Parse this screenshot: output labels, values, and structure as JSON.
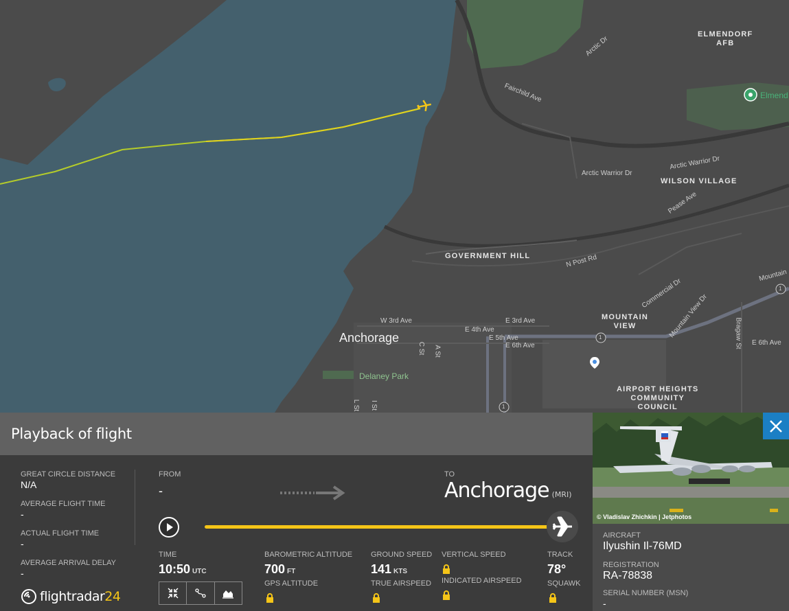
{
  "map": {
    "labels": {
      "elmendorf_afb": "ELMENDORF\nAFB",
      "elmendorf_poi": "Elmend",
      "arctic_warrior_dr_1": "Arctic Warrior Dr",
      "arctic_warrior_dr_2": "Arctic Warrior Dr",
      "wilson_village": "WILSON VILLAGE",
      "fairchild_ave": "Fairchild Ave",
      "arctic_dr": "Arctic Dr",
      "pease_ave": "Pease Ave",
      "government_hill": "GOVERNMENT HILL",
      "n_post_rd": "N Post Rd",
      "commercial_dr": "Commercial Dr",
      "mountain_view_dr": "Mountain View Dr",
      "mountain_view": "MOUNTAIN\nVIEW",
      "mountain_edge": "Mountain",
      "bragaw_st": "Bragaw St",
      "e_6th_ave_right": "E 6th Ave",
      "w_3rd_ave": "W 3rd Ave",
      "e_3rd_ave": "E 3rd Ave",
      "e_4th_ave": "E 4th Ave",
      "e_5th_ave": "E 5th Ave",
      "e_6th_ave": "E 6th Ave",
      "anchorage": "Anchorage",
      "c_st": "C St",
      "a_st": "A St",
      "delaney_park": "Delaney Park",
      "l_st": "L St",
      "i_st": "I St",
      "airport_heights": "AIRPORT HEIGHTS\nCOMMUNITY\nCOUNCIL",
      "route_1a": "1",
      "route_1b": "1",
      "route_1c": "1"
    },
    "colors": {
      "water": "#44606d",
      "land": "#4b4b4b",
      "track_yellow": "#e8d21c",
      "track_green": "#9ccc2a",
      "park": "#4f6a50"
    }
  },
  "panel": {
    "title": "Playback of flight",
    "stats": {
      "great_circle_distance_label": "GREAT CIRCLE DISTANCE",
      "great_circle_distance_value": "N/A",
      "average_flight_time_label": "AVERAGE FLIGHT TIME",
      "average_flight_time_value": "-",
      "actual_flight_time_label": "ACTUAL FLIGHT TIME",
      "actual_flight_time_value": "-",
      "average_arrival_delay_label": "AVERAGE ARRIVAL DELAY",
      "average_arrival_delay_value": "-"
    },
    "route": {
      "from_label": "FROM",
      "from_value": "-",
      "to_label": "TO",
      "to_city": "Anchorage",
      "to_code": "(MRI)"
    },
    "playback": {
      "progress": 1.0
    },
    "telemetry": {
      "time_label": "TIME",
      "time_value": "10:50",
      "time_unit": "UTC",
      "baro_alt_label": "BAROMETRIC ALTITUDE",
      "baro_alt_value": "700",
      "baro_alt_unit": "FT",
      "gps_alt_label": "GPS ALTITUDE",
      "ground_speed_label": "GROUND SPEED",
      "ground_speed_value": "141",
      "ground_speed_unit": "KTS",
      "true_airspeed_label": "TRUE AIRSPEED",
      "vertical_speed_label": "VERTICAL SPEED",
      "indicated_airspeed_label": "INDICATED AIRSPEED",
      "track_label": "TRACK",
      "track_value": "78°",
      "squawk_label": "SQUAWK"
    },
    "logo": {
      "text": "flightradar",
      "suffix": "24"
    }
  },
  "aircraft": {
    "photo_credit": "© Vladislav Zhichkin | Jetphotos",
    "aircraft_label": "AIRCRAFT",
    "aircraft_value": "Ilyushin Il-76MD",
    "registration_label": "REGISTRATION",
    "registration_value": "RA-78838",
    "serial_label": "SERIAL NUMBER (MSN)",
    "serial_value": "-"
  },
  "colors": {
    "accent_yellow": "#f5c518",
    "close_blue": "#1b7fc4"
  }
}
